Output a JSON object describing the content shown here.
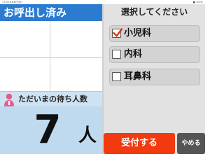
{
  "status_bar": {
    "time": "17:05",
    "date": "8月8日(水)",
    "battery": "■ 100%"
  },
  "called": {
    "title": "お呼出し済み",
    "numbers": []
  },
  "waiting": {
    "label": "ただいまの待ち人数",
    "count": "7",
    "unit": "人"
  },
  "selection": {
    "header": "選択してください",
    "options": [
      {
        "label": "小児科",
        "checked": true
      },
      {
        "label": "内科",
        "checked": false
      },
      {
        "label": "耳鼻科",
        "checked": false
      }
    ]
  },
  "buttons": {
    "accept": "受付する",
    "cancel": "やめる"
  },
  "colors": {
    "header_blue": "#2b7bd1",
    "accept_red": "#f23a10",
    "check_red": "#e0321a",
    "person_pink": "#e85a8a"
  }
}
